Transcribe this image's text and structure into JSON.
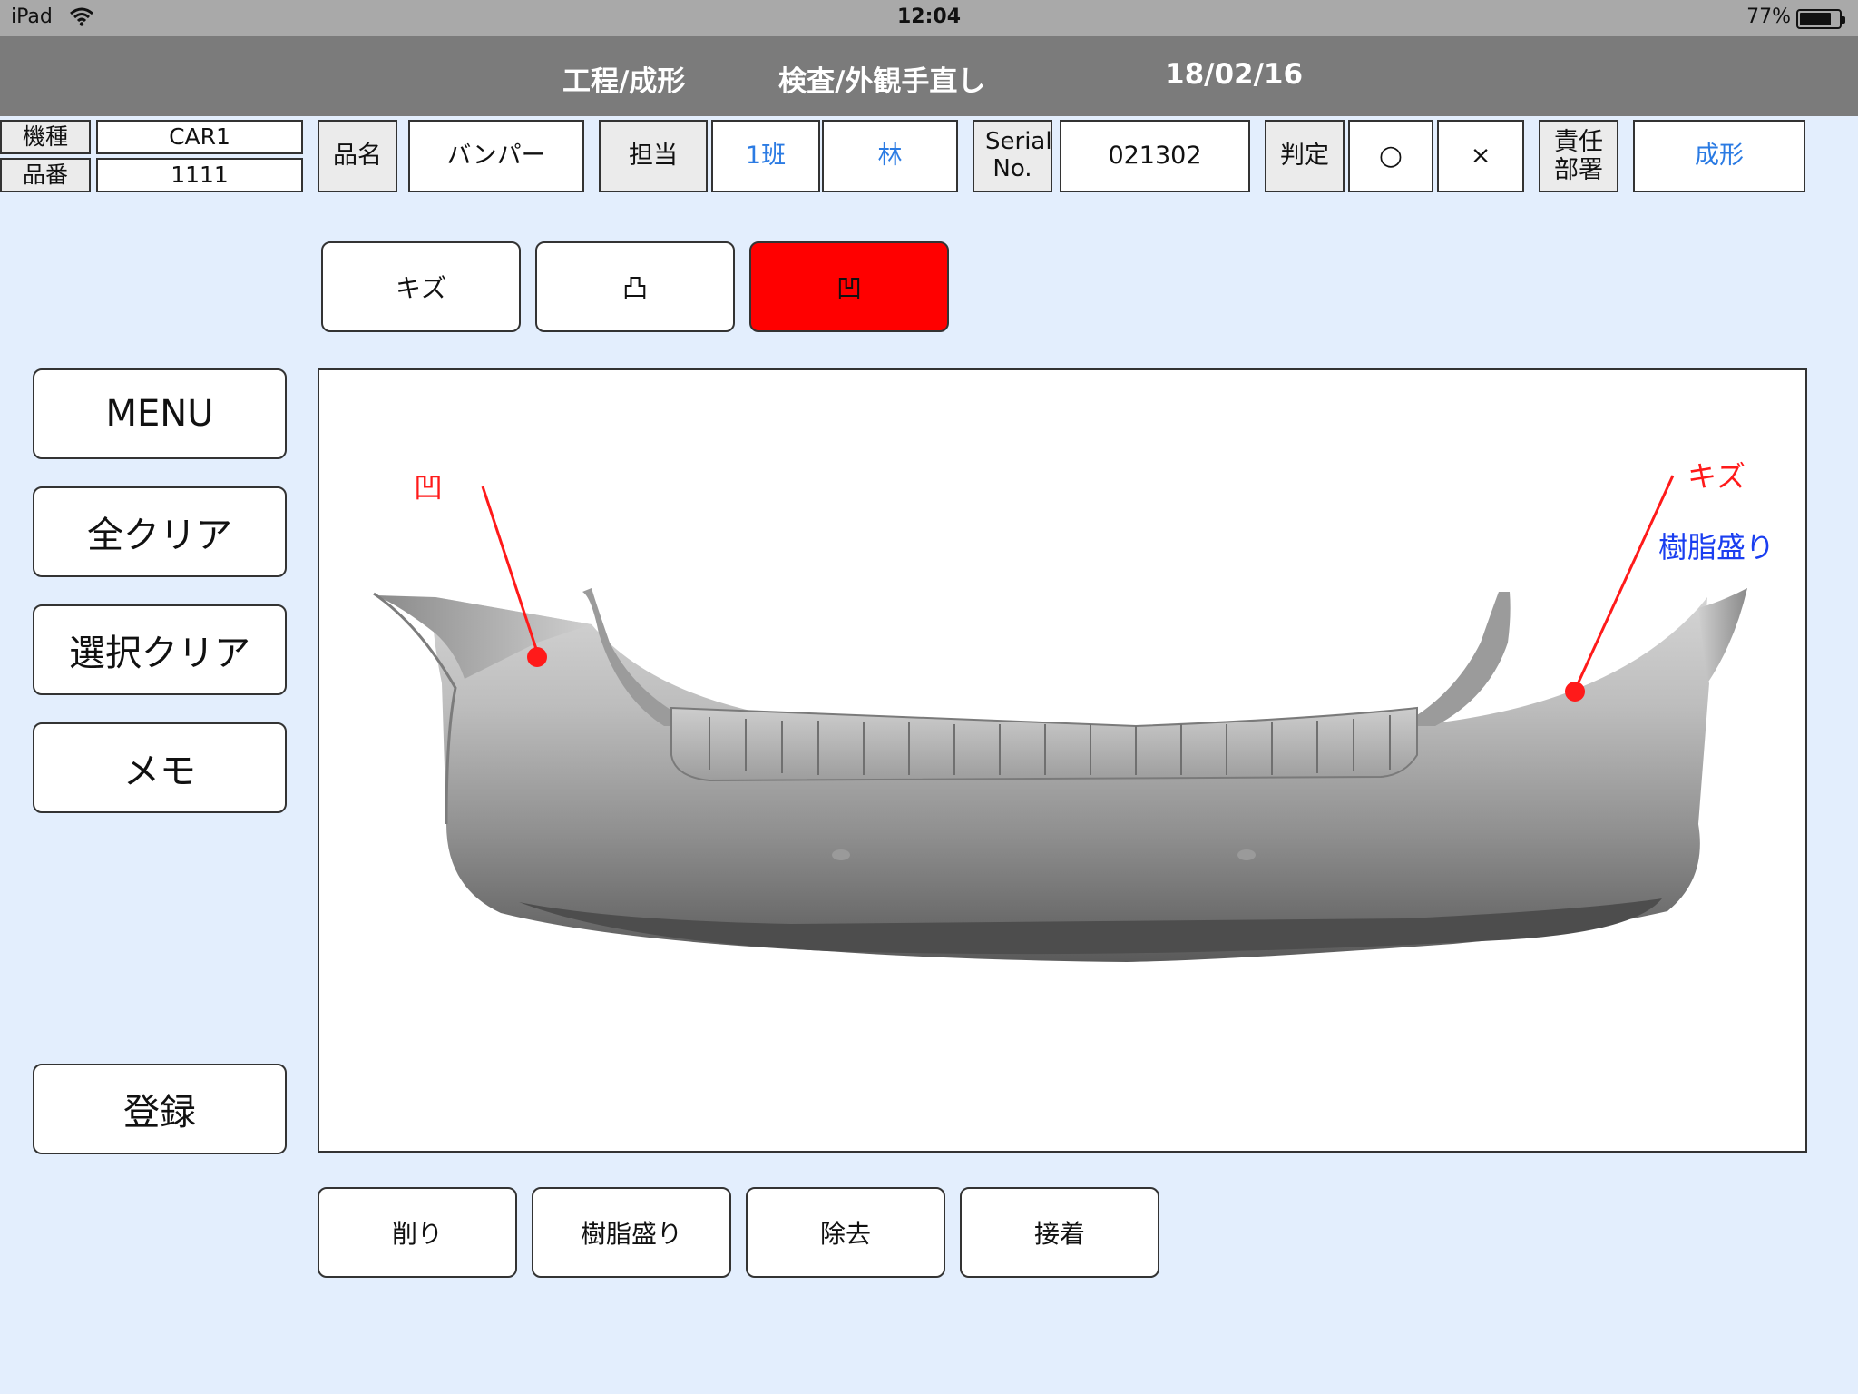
{
  "status_bar": {
    "device": "iPad",
    "time": "12:04",
    "battery": "77%"
  },
  "header": {
    "process": "工程/成形",
    "task": "検査/外観手直し",
    "date": "18/02/16"
  },
  "info": {
    "model_label": "機種",
    "model_value": "CAR1",
    "part_no_label": "品番",
    "part_no_value": "1111",
    "item_name_label": "品名",
    "item_name_value": "バンパー",
    "assignee_label": "担当",
    "team": "1班",
    "person": "林",
    "serial_label": "Serial No.",
    "serial_value": "021302",
    "judgement_label": "判定",
    "judge_ok": "○",
    "judge_ng": "×",
    "dept_label": "責任部署",
    "dept_value": "成形"
  },
  "defect_types": [
    {
      "label": "キズ",
      "selected": false
    },
    {
      "label": "凸",
      "selected": false
    },
    {
      "label": "凹",
      "selected": true
    }
  ],
  "side_menu": {
    "menu": "MENU",
    "clear_all": "全クリア",
    "clear_selection": "選択クリア",
    "memo": "メモ",
    "register": "登録"
  },
  "annotations": [
    {
      "label": "凹",
      "color": "#ff1a1a"
    },
    {
      "label": "キズ",
      "color": "#ff1a1a"
    },
    {
      "label": "樹脂盛り",
      "color": "#1a3ef0"
    }
  ],
  "repair_actions": [
    "削り",
    "樹脂盛り",
    "除去",
    "接着"
  ],
  "colors": {
    "selected_button": "#ff0000",
    "header_bg": "#7b7b7b",
    "page_bg": "#e3eefd",
    "link_blue": "#2b7be3"
  }
}
